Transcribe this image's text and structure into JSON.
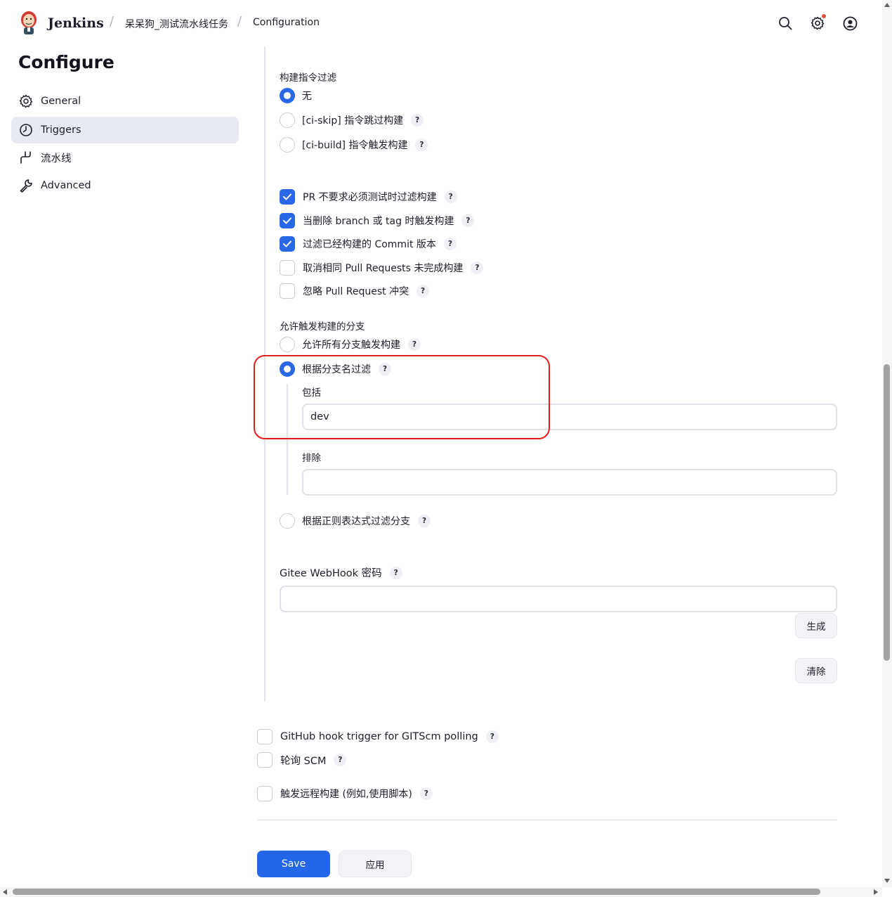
{
  "header": {
    "brand": "Jenkins",
    "breadcrumb": [
      "呆呆狗_测试流水线任务",
      "Configuration"
    ]
  },
  "sidebar": {
    "title": "Configure",
    "items": [
      {
        "label": "General",
        "icon": "gear-icon",
        "active": false
      },
      {
        "label": "Triggers",
        "icon": "clock-icon",
        "active": true
      },
      {
        "label": "流水线",
        "icon": "pipeline-icon",
        "active": false
      },
      {
        "label": "Advanced",
        "icon": "wrench-icon",
        "active": false
      }
    ]
  },
  "build_filter": {
    "label": "构建指令过滤",
    "options": [
      {
        "label": "无",
        "selected": true
      },
      {
        "label": "[ci-skip] 指令跳过构建",
        "selected": false,
        "help": "?"
      },
      {
        "label": "[ci-build] 指令触发构建",
        "selected": false,
        "help": "?"
      }
    ]
  },
  "checkbox_options": [
    {
      "label": "PR 不要求必须测试时过滤构建",
      "checked": true,
      "help": "?"
    },
    {
      "label": "当删除 branch 或 tag 时触发构建",
      "checked": true,
      "help": "?"
    },
    {
      "label": "过滤已经构建的 Commit 版本",
      "checked": true,
      "help": "?"
    },
    {
      "label": "取消相同 Pull Requests 未完成构建",
      "checked": false,
      "help": "?"
    },
    {
      "label": "忽略 Pull Request 冲突",
      "checked": false,
      "help": "?"
    }
  ],
  "branch_trigger": {
    "label": "允许触发构建的分支",
    "options": [
      {
        "label": "允许所有分支触发构建",
        "selected": false,
        "help": "?"
      },
      {
        "label": "根据分支名过滤",
        "selected": true,
        "help": "?"
      },
      {
        "label": "根据正则表达式过滤分支",
        "selected": false,
        "help": "?"
      }
    ],
    "include_label": "包括",
    "include_value": "dev",
    "exclude_label": "排除",
    "exclude_value": ""
  },
  "webhook": {
    "label": "Gitee WebHook 密码",
    "help": "?",
    "value": "",
    "generate_label": "生成",
    "clear_label": "清除"
  },
  "other_triggers": [
    {
      "label": "GitHub hook trigger for GITScm polling",
      "checked": false,
      "help": "?"
    },
    {
      "label": "轮询 SCM",
      "checked": false,
      "help": "?"
    },
    {
      "label": "触发远程构建 (例如,使用脚本)",
      "checked": false,
      "help": "?"
    }
  ],
  "footer": {
    "save_label": "Save",
    "apply_label": "应用"
  },
  "colors": {
    "accent": "#2466e8",
    "highlight": "#e0201b"
  }
}
